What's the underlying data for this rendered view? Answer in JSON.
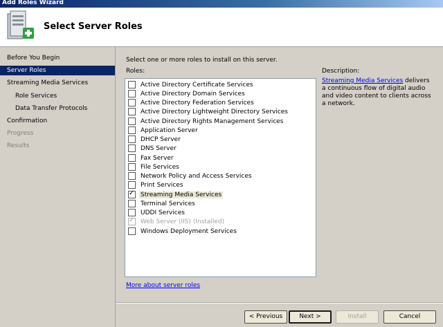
{
  "window": {
    "title": "Add Roles Wizard"
  },
  "header": {
    "title": "Select Server Roles",
    "icon": "server-add-icon"
  },
  "sidebar": {
    "items": [
      {
        "label": "Before You Begin",
        "state": "normal"
      },
      {
        "label": "Server Roles",
        "state": "active"
      },
      {
        "label": "Streaming Media Services",
        "state": "normal"
      },
      {
        "label": "Role Services",
        "state": "normal",
        "sub": true
      },
      {
        "label": "Data Transfer Protocols",
        "state": "normal",
        "sub": true
      },
      {
        "label": "Confirmation",
        "state": "normal"
      },
      {
        "label": "Progress",
        "state": "disabled"
      },
      {
        "label": "Results",
        "state": "disabled"
      }
    ]
  },
  "main": {
    "instruction": "Select one or more roles to install on this server.",
    "roles_label": "Roles:",
    "roles": [
      {
        "label": "Active Directory Certificate Services",
        "checked": false,
        "disabled": false
      },
      {
        "label": "Active Directory Domain Services",
        "checked": false,
        "disabled": false
      },
      {
        "label": "Active Directory Federation Services",
        "checked": false,
        "disabled": false
      },
      {
        "label": "Active Directory Lightweight Directory Services",
        "checked": false,
        "disabled": false
      },
      {
        "label": "Active Directory Rights Management Services",
        "checked": false,
        "disabled": false
      },
      {
        "label": "Application Server",
        "checked": false,
        "disabled": false
      },
      {
        "label": "DHCP Server",
        "checked": false,
        "disabled": false
      },
      {
        "label": "DNS Server",
        "checked": false,
        "disabled": false
      },
      {
        "label": "Fax Server",
        "checked": false,
        "disabled": false
      },
      {
        "label": "File Services",
        "checked": false,
        "disabled": false
      },
      {
        "label": "Network Policy and Access Services",
        "checked": false,
        "disabled": false
      },
      {
        "label": "Print Services",
        "checked": false,
        "disabled": false
      },
      {
        "label": "Streaming Media Services",
        "checked": true,
        "disabled": false,
        "selected": true
      },
      {
        "label": "Terminal Services",
        "checked": false,
        "disabled": false
      },
      {
        "label": "UDDI Services",
        "checked": false,
        "disabled": false
      },
      {
        "label": "Web Server (IIS)  (Installed)",
        "checked": true,
        "disabled": true
      },
      {
        "label": "Windows Deployment Services",
        "checked": false,
        "disabled": false
      }
    ],
    "more_link": "More about server roles",
    "description_label": "Description:",
    "description_link": "Streaming Media Services",
    "description_text": " delivers a continuous flow of digital audio and video content to clients across a network."
  },
  "buttons": {
    "previous": "< Previous",
    "next": "Next >",
    "install": "Install",
    "cancel": "Cancel"
  }
}
